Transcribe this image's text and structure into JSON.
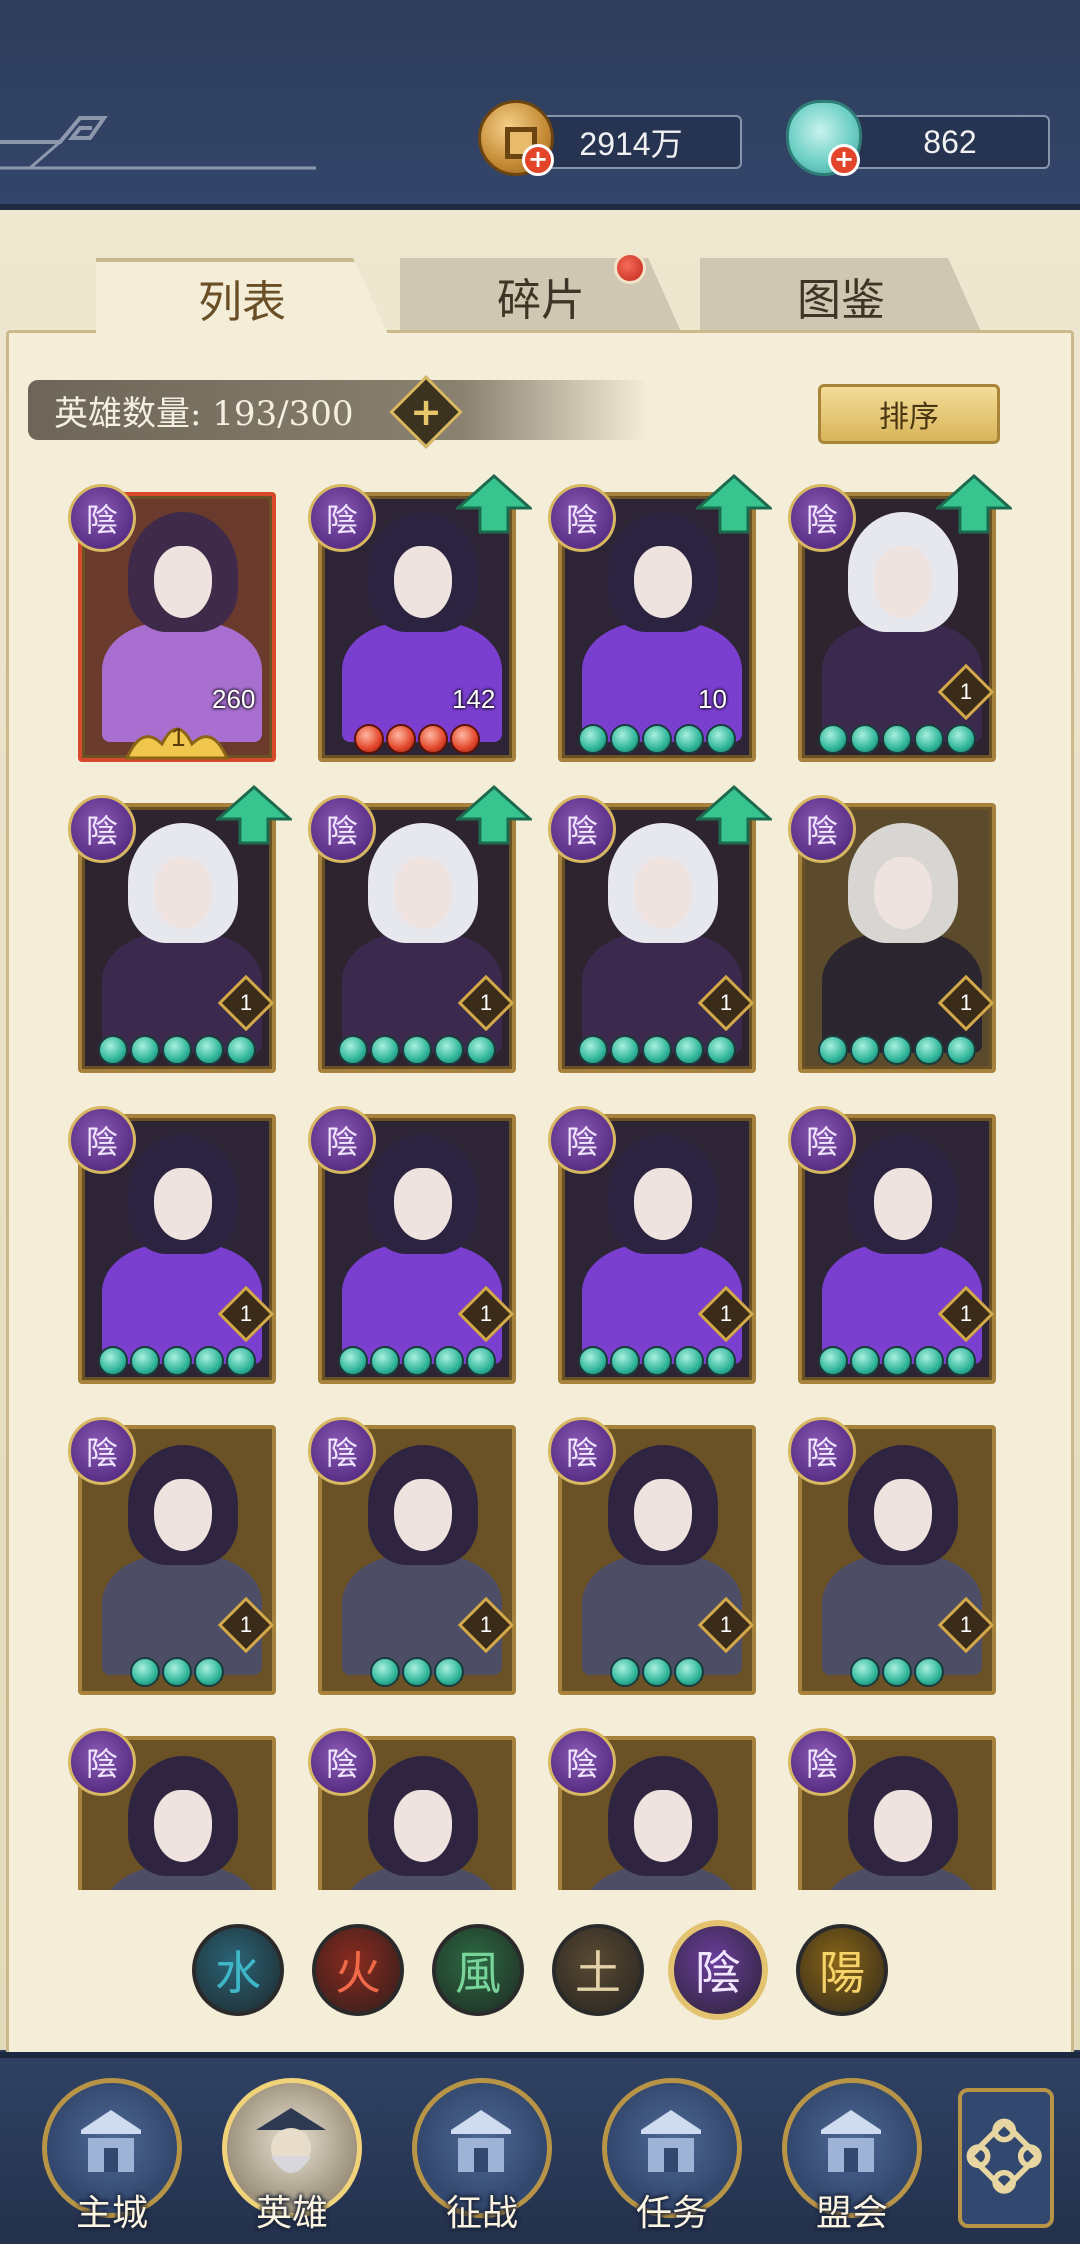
{
  "header": {
    "gold_amount": "2914万",
    "jade_amount": "862",
    "gold_icon": "copper-coin-icon",
    "jade_icon": "jade-pouch-icon"
  },
  "tabs": [
    {
      "label": "列表",
      "active": true
    },
    {
      "label": "碎片",
      "active": false,
      "has_notification": true
    },
    {
      "label": "图鉴",
      "active": false
    }
  ],
  "hero_count_label": "英雄数量: 193/300",
  "sort_button": "排序",
  "heroes": [
    {
      "element": "陰",
      "level": "260",
      "stars": 1,
      "star_text": "1",
      "promotable": false,
      "hero": "fan-lady",
      "frame": "red"
    },
    {
      "element": "陰",
      "level": "142",
      "stars": 4,
      "star_color": "red",
      "promotable": true,
      "hero": "purple-swordsman"
    },
    {
      "element": "陰",
      "level": "10",
      "stars": 5,
      "star_color": "green",
      "promotable": true,
      "hero": "purple-swordsman"
    },
    {
      "element": "陰",
      "level": "1",
      "stars": 5,
      "star_color": "green",
      "promotable": true,
      "hero": "masked-assassin"
    },
    {
      "element": "陰",
      "level": "1",
      "stars": 5,
      "star_color": "green",
      "promotable": true,
      "hero": "masked-assassin"
    },
    {
      "element": "陰",
      "level": "1",
      "stars": 5,
      "star_color": "green",
      "promotable": true,
      "hero": "masked-assassin"
    },
    {
      "element": "陰",
      "level": "1",
      "stars": 5,
      "star_color": "green",
      "promotable": true,
      "hero": "masked-assassin"
    },
    {
      "element": "陰",
      "level": "1",
      "stars": 5,
      "star_color": "green",
      "promotable": false,
      "hero": "white-hair-warrior"
    },
    {
      "element": "陰",
      "level": "1",
      "stars": 5,
      "star_color": "green",
      "promotable": false,
      "hero": "purple-swordsman"
    },
    {
      "element": "陰",
      "level": "1",
      "stars": 5,
      "star_color": "green",
      "promotable": false,
      "hero": "purple-swordsman"
    },
    {
      "element": "陰",
      "level": "1",
      "stars": 5,
      "star_color": "green",
      "promotable": false,
      "hero": "purple-swordsman"
    },
    {
      "element": "陰",
      "level": "1",
      "stars": 5,
      "star_color": "green",
      "promotable": false,
      "hero": "purple-swordsman"
    },
    {
      "element": "陰",
      "level": "1",
      "stars": 3,
      "star_color": "green",
      "promotable": false,
      "hero": "long-hair-scholar"
    },
    {
      "element": "陰",
      "level": "1",
      "stars": 3,
      "star_color": "green",
      "promotable": false,
      "hero": "long-hair-scholar"
    },
    {
      "element": "陰",
      "level": "1",
      "stars": 3,
      "star_color": "green",
      "promotable": false,
      "hero": "long-hair-scholar"
    },
    {
      "element": "陰",
      "level": "1",
      "stars": 3,
      "star_color": "green",
      "promotable": false,
      "hero": "long-hair-scholar"
    },
    {
      "element": "陰",
      "level": "",
      "stars": 0,
      "promotable": false,
      "hero": "long-hair-scholar"
    },
    {
      "element": "陰",
      "level": "",
      "stars": 0,
      "promotable": false,
      "hero": "long-hair-scholar"
    },
    {
      "element": "陰",
      "level": "",
      "stars": 0,
      "promotable": false,
      "hero": "long-hair-scholar"
    },
    {
      "element": "陰",
      "level": "",
      "stars": 0,
      "promotable": false,
      "hero": "long-hair-scholar"
    }
  ],
  "element_filters": [
    {
      "glyph": "水",
      "name": "water",
      "color": "#3fb7c9",
      "bg": "#2a6477",
      "active": false
    },
    {
      "glyph": "火",
      "name": "fire",
      "color": "#f06a4a",
      "bg": "#8a2a1e",
      "active": false
    },
    {
      "glyph": "風",
      "name": "wind",
      "color": "#79d49a",
      "bg": "#2c6b43",
      "active": false
    },
    {
      "glyph": "土",
      "name": "earth",
      "color": "#e4d3a8",
      "bg": "#5a4a33",
      "active": false
    },
    {
      "glyph": "陰",
      "name": "yin",
      "color": "#f1e6ff",
      "bg": "#6b3e9c",
      "active": true
    },
    {
      "glyph": "陽",
      "name": "yang",
      "color": "#f7d46a",
      "bg": "#8a6517",
      "active": false
    }
  ],
  "bottom_nav": [
    {
      "label": "主城",
      "icon": "city-gate-icon",
      "active": false
    },
    {
      "label": "英雄",
      "icon": "hero-portrait-icon",
      "active": true
    },
    {
      "label": "征战",
      "icon": "war-helmet-icon",
      "active": false
    },
    {
      "label": "任务",
      "icon": "scroll-task-icon",
      "active": false
    },
    {
      "label": "盟会",
      "icon": "alliance-pavilion-icon",
      "active": false
    }
  ],
  "colors": {
    "accent_gold": "#d8b862",
    "yin_purple": "#6b3e9c",
    "promote_green": "#2fb59a"
  }
}
